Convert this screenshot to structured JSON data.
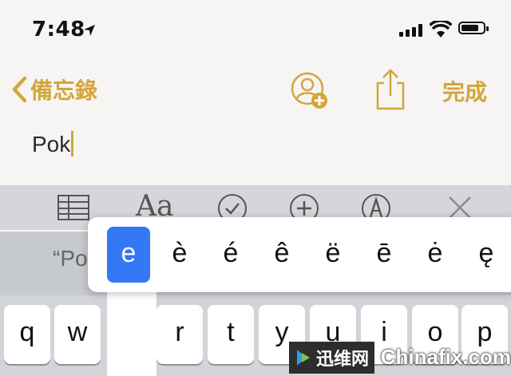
{
  "status_bar": {
    "time": "7:48",
    "location_icon": "location-arrow-icon",
    "signal_icon": "cellular-signal-icon",
    "wifi_icon": "wifi-icon",
    "battery_icon": "battery-icon",
    "battery_level": 0.8
  },
  "nav": {
    "back_label": "備忘錄",
    "back_icon": "chevron-left-icon",
    "add_person_icon": "add-person-icon",
    "share_icon": "share-icon",
    "done_label": "完成",
    "accent_color": "#d4a53a"
  },
  "note": {
    "text": "Pok"
  },
  "toolbar": {
    "table_icon": "table-icon",
    "format_label": "Aa",
    "checklist_icon": "checkmark-circle-icon",
    "add_icon": "plus-circle-icon",
    "markup_icon": "pen-circle-icon",
    "close_icon": "close-icon"
  },
  "suggestion": {
    "text": "“Po"
  },
  "accent_popup": {
    "options": [
      "e",
      "è",
      "é",
      "ê",
      "ë",
      "ē",
      "ė",
      "ę"
    ],
    "selected": "e",
    "selected_color": "#3478f6"
  },
  "keyboard": {
    "row1": [
      "q",
      "w",
      "r",
      "t",
      "y",
      "u",
      "i",
      "o",
      "p"
    ]
  },
  "watermark": {
    "cn": "迅维网",
    "en": "Chinafix.com"
  }
}
